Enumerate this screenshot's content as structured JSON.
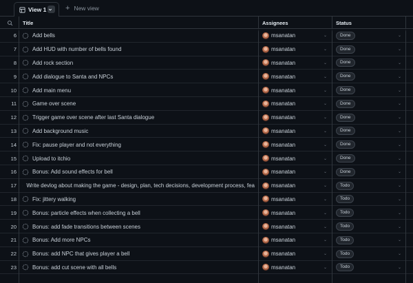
{
  "tabs": {
    "active_label": "View 1",
    "new_view_label": "New view"
  },
  "columns": {
    "title": "Title",
    "assignees": "Assignees",
    "status": "Status"
  },
  "rows": [
    {
      "num": "6",
      "title": "Add bells",
      "assignee": "msanatan",
      "status": "Done"
    },
    {
      "num": "7",
      "title": "Add HUD with number of bells found",
      "assignee": "msanatan",
      "status": "Done"
    },
    {
      "num": "8",
      "title": "Add rock section",
      "assignee": "msanatan",
      "status": "Done"
    },
    {
      "num": "9",
      "title": "Add dialogue to Santa and NPCs",
      "assignee": "msanatan",
      "status": "Done"
    },
    {
      "num": "10",
      "title": "Add main menu",
      "assignee": "msanatan",
      "status": "Done"
    },
    {
      "num": "11",
      "title": "Game over scene",
      "assignee": "msanatan",
      "status": "Done"
    },
    {
      "num": "12",
      "title": "Trigger game over scene after last Santa dialogue",
      "assignee": "msanatan",
      "status": "Done"
    },
    {
      "num": "13",
      "title": "Add background music",
      "assignee": "msanatan",
      "status": "Done"
    },
    {
      "num": "14",
      "title": "Fix: pause player and not everything",
      "assignee": "msanatan",
      "status": "Done"
    },
    {
      "num": "15",
      "title": "Upload to itchio",
      "assignee": "msanatan",
      "status": "Done"
    },
    {
      "num": "16",
      "title": "Bonus: Add sound effects for bell",
      "assignee": "msanatan",
      "status": "Done"
    },
    {
      "num": "17",
      "title": "Write devlog about making the game - design, plan, tech decisions, development process, fea",
      "assignee": "msanatan",
      "status": "Todo"
    },
    {
      "num": "18",
      "title": "Fix: jittery walking",
      "assignee": "msanatan",
      "status": "Todo"
    },
    {
      "num": "19",
      "title": "Bonus: particle effects when collecting a bell",
      "assignee": "msanatan",
      "status": "Todo"
    },
    {
      "num": "20",
      "title": "Bonus: add fade transitions between scenes",
      "assignee": "msanatan",
      "status": "Todo"
    },
    {
      "num": "21",
      "title": "Bonus: Add more NPCs",
      "assignee": "msanatan",
      "status": "Todo"
    },
    {
      "num": "22",
      "title": "Bonus: add NPC that gives player a bell",
      "assignee": "msanatan",
      "status": "Todo"
    },
    {
      "num": "23",
      "title": "Bonus: add cut scene with all bells",
      "assignee": "msanatan",
      "status": "Todo"
    }
  ],
  "icons": {
    "tab": "table-icon",
    "search": "search-icon",
    "issue": "draft-issue-icon"
  },
  "colors": {
    "background": "#0d1117",
    "border": "#30363d",
    "text": "#c9d1d9"
  }
}
